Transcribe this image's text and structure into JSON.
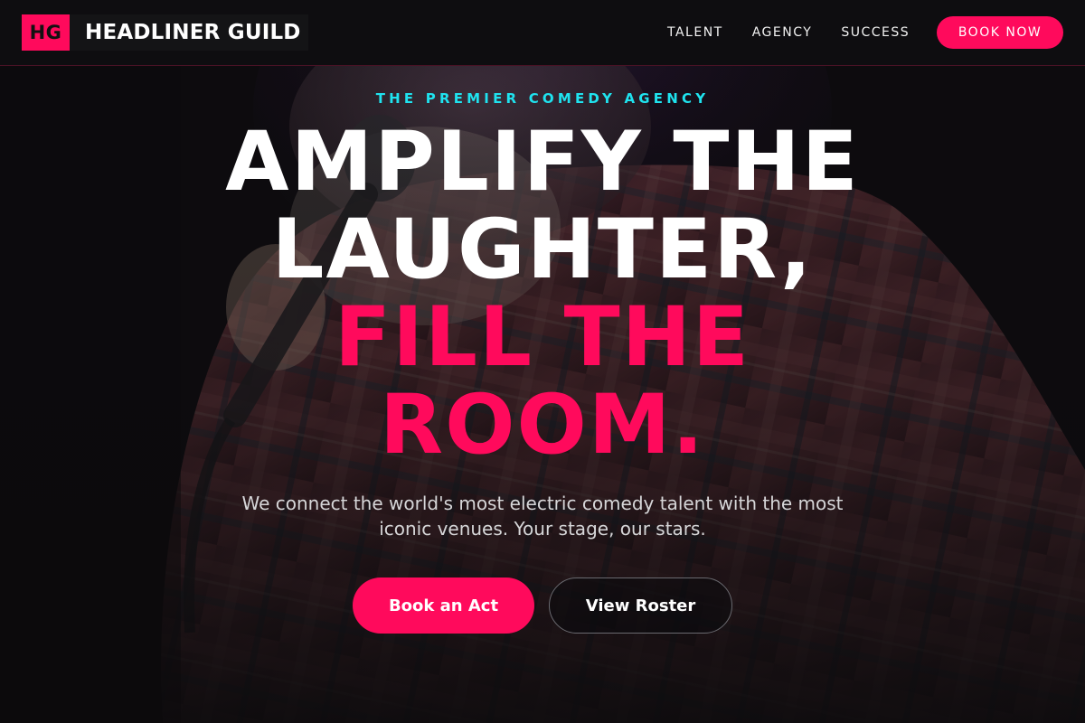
{
  "brand": {
    "mark": "HG",
    "name": "HEADLINER GUILD"
  },
  "nav": {
    "links": [
      "TALENT",
      "AGENCY",
      "SUCCESS"
    ],
    "cta": "BOOK NOW"
  },
  "hero": {
    "eyebrow": "THE PREMIER COMEDY AGENCY",
    "headline_lines": [
      "AMPLIFY THE",
      "LAUGHTER,",
      "FILL THE",
      "ROOM."
    ],
    "subcopy": "We connect the world's most electric comedy talent with the most iconic venues. Your stage, our stars.",
    "primary_button": "Book an Act",
    "secondary_button": "View Roster"
  },
  "colors": {
    "accent": "#ff0a5c",
    "eyebrow": "#1fe3ef",
    "background": "#0c0b0d"
  }
}
